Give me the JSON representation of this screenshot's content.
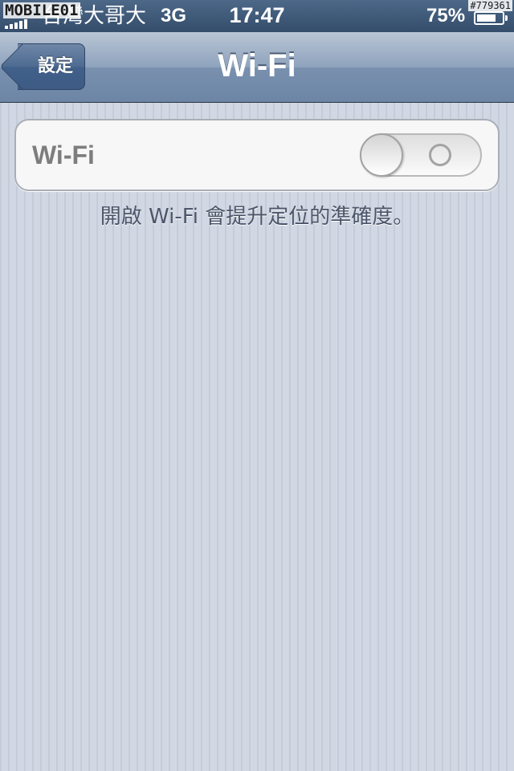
{
  "status_bar": {
    "watermark": "MOBILE01",
    "signal_icon": "signal-bars-icon",
    "carrier": "台灣大哥大",
    "network": "3G",
    "time": "17:47",
    "battery_percent": "75%",
    "battery_level": 0.75,
    "battery_icon": "battery-icon",
    "photo_id": "#779361"
  },
  "nav_bar": {
    "back_label": "設定",
    "title": "Wi-Fi"
  },
  "wifi_cell": {
    "label": "Wi-Fi",
    "toggle_on": false
  },
  "footer_note": "開啟 Wi-Fi 會提升定位的準確度。",
  "colors": {
    "nav_bar": "#6d86a6",
    "background": "#cbd2de",
    "cell_bg": "#f7f7f7",
    "label_text": "#7d7d7d",
    "footer_text": "#4c566a"
  }
}
